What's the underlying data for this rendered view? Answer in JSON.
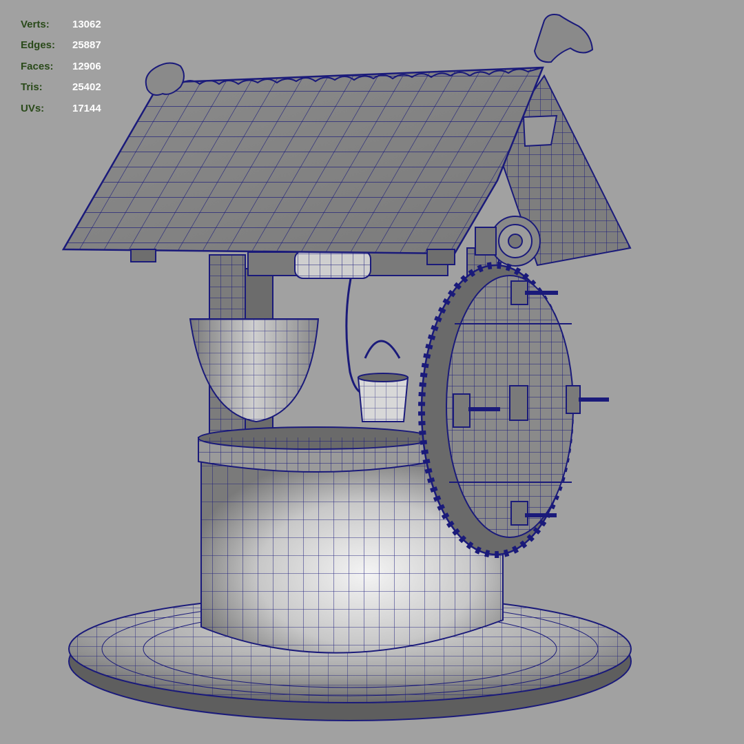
{
  "viewport": {
    "background": "#a1a1a1",
    "wire_color": "#1a1a7a",
    "mesh_fill": "#8a8a8a",
    "mesh_light": "#e6e6e6"
  },
  "hud": {
    "label_color": "#2a4a1a",
    "value_color": "#ffffff",
    "stats": [
      {
        "label": "Verts:",
        "value": "13062"
      },
      {
        "label": "Edges:",
        "value": "25887"
      },
      {
        "label": "Faces:",
        "value": "12906"
      },
      {
        "label": "Tris:",
        "value": "25402"
      },
      {
        "label": "UVs:",
        "value": "17144"
      }
    ]
  },
  "model": {
    "parts": [
      "roof",
      "roof-side-gable",
      "crank-axle",
      "support-post",
      "bucket",
      "rope",
      "hanging-scoop",
      "well-rim",
      "well-body",
      "base-platform",
      "crank-wheel",
      "crank-handles"
    ]
  }
}
